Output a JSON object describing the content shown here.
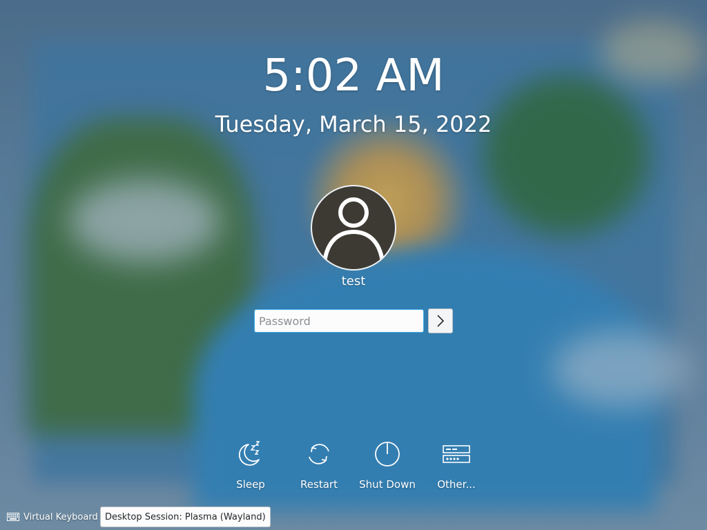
{
  "clock": {
    "time": "5:02 AM",
    "date": "Tuesday, March 15, 2022"
  },
  "user": {
    "name": "test",
    "avatar_icon": "user-icon"
  },
  "login": {
    "password_placeholder": "Password",
    "password_value": "",
    "submit_icon": "chevron-right-icon"
  },
  "actions": [
    {
      "id": "sleep",
      "label": "Sleep",
      "icon": "sleep-icon"
    },
    {
      "id": "restart",
      "label": "Restart",
      "icon": "restart-icon"
    },
    {
      "id": "shutdown",
      "label": "Shut Down",
      "icon": "power-icon"
    },
    {
      "id": "other",
      "label": "Other...",
      "icon": "switch-user-icon"
    }
  ],
  "footer": {
    "virtual_keyboard_label": "Virtual Keyboard",
    "session_label": "Desktop Session: Plasma (Wayland)"
  },
  "colors": {
    "text": "#ffffff",
    "input_focus_border": "#3daee9",
    "input_background": "#fcfcfc"
  }
}
